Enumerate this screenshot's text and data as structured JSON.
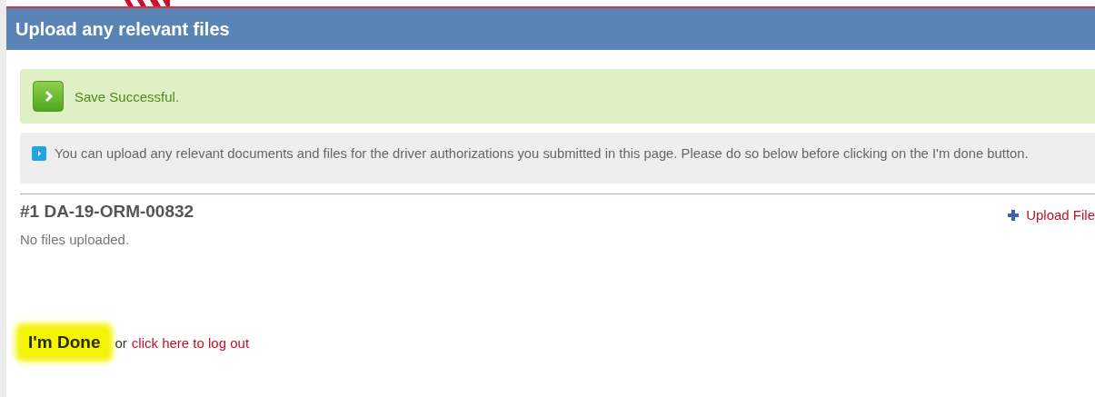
{
  "header": {
    "title": "Upload any relevant files"
  },
  "success_alert": {
    "text": "Save Successful."
  },
  "info_alert": {
    "text": "You can upload any relevant documents and files for the driver authorizations you submitted in this page. Please do so below before clicking on the I'm done button."
  },
  "authorizations": [
    {
      "title": "#1 DA-19-ORM-00832",
      "upload_link": "Upload File",
      "status": "No files uploaded."
    }
  ],
  "footer": {
    "done_button": "I'm Done",
    "highlighted": true,
    "separator": "or",
    "logout_link": "click here to log out"
  }
}
